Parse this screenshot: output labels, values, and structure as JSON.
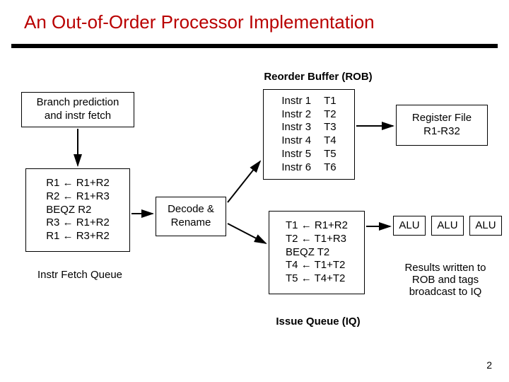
{
  "title": "An Out-of-Order Processor Implementation",
  "labels": {
    "rob": "Reorder Buffer (ROB)",
    "branch_pred": "Branch prediction\nand instr fetch",
    "ifq": "Instr Fetch Queue",
    "decode": "Decode &\nRename",
    "regfile": "Register File\nR1-R32",
    "iq": "Issue Queue (IQ)",
    "alu": "ALU",
    "results": "Results written to\nROB and tags\nbroadcast to IQ"
  },
  "rob_rows": [
    {
      "i": "Instr 1",
      "t": "T1"
    },
    {
      "i": "Instr 2",
      "t": "T2"
    },
    {
      "i": "Instr 3",
      "t": "T3"
    },
    {
      "i": "Instr 4",
      "t": "T4"
    },
    {
      "i": "Instr 5",
      "t": "T5"
    },
    {
      "i": "Instr 6",
      "t": "T6"
    }
  ],
  "fetch_instrs": [
    "R1 ← R1+R2",
    "R2 ← R1+R3",
    "BEQZ R2",
    "R3 ← R1+R2",
    "R1 ← R3+R2"
  ],
  "iq_instrs": [
    "T1 ← R1+R2",
    "T2 ← T1+R3",
    "BEQZ T2",
    "T4 ← T1+T2",
    "T5 ← T4+T2"
  ],
  "page_number": "2"
}
